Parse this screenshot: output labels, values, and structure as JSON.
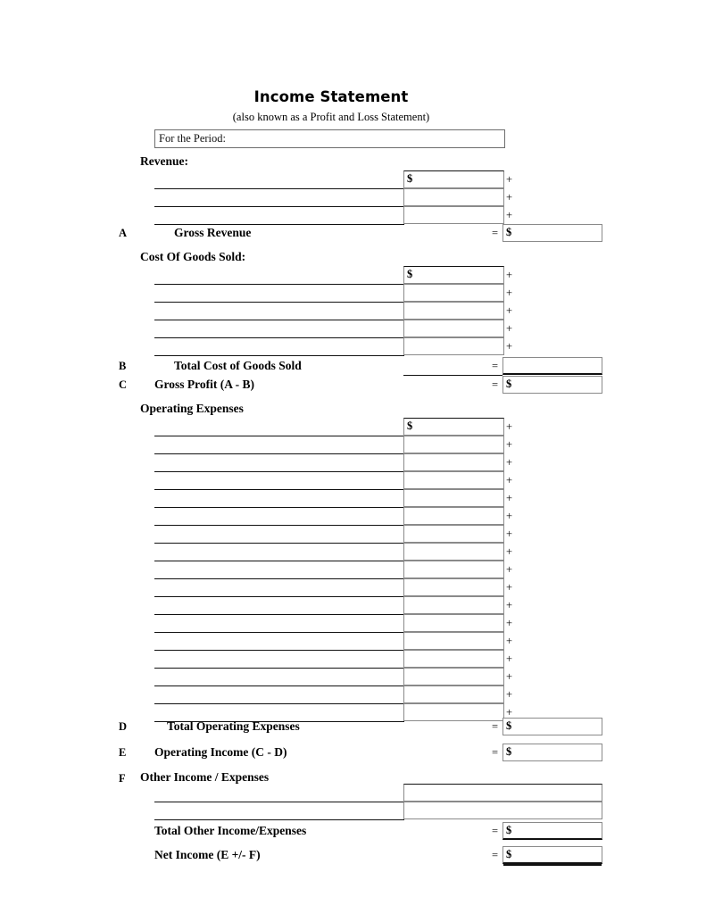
{
  "document": {
    "title": "Income Statement",
    "subtitle": "(also known as a Profit and Loss Statement)"
  },
  "period_field": {
    "label": "For the Period:",
    "value": "",
    "placeholder": ""
  },
  "symbols": {
    "dollar": "$",
    "plus": "+",
    "equals": "="
  },
  "sections": [
    {
      "id": "revenue",
      "heading": "Revenue:",
      "entry_rows": 3,
      "first_row_dollar": true,
      "operator": "+"
    },
    {
      "id": "cogs",
      "heading": "Cost Of Goods Sold:",
      "entry_rows": 5,
      "first_row_dollar": true,
      "operator": "+"
    },
    {
      "id": "opex",
      "heading": "Operating Expenses",
      "entry_rows": 17,
      "first_row_dollar": true,
      "operator": "+"
    },
    {
      "id": "other",
      "heading": "Other Income / Expenses",
      "entry_rows": 2,
      "first_row_dollar": false,
      "operator": ""
    }
  ],
  "totals": {
    "gross_revenue": {
      "letter": "A",
      "label": "Gross Revenue",
      "operator": "=",
      "dollar": "$",
      "value": ""
    },
    "total_cogs": {
      "letter": "B",
      "label": "Total Cost of Goods Sold",
      "operator": "=",
      "dollar": "",
      "value": ""
    },
    "gross_profit": {
      "letter": "C",
      "label": "Gross Profit (A - B)",
      "operator": "=",
      "dollar": "$",
      "value": ""
    },
    "total_opex": {
      "letter": "D",
      "label": "Total Operating Expenses",
      "operator": "=",
      "dollar": "$",
      "value": ""
    },
    "operating_income": {
      "letter": "E",
      "label": "Operating Income (C - D)",
      "operator": "=",
      "dollar": "$",
      "value": ""
    },
    "other_heading": {
      "letter": "F",
      "label": "Other Income / Expenses"
    },
    "total_other": {
      "letter": "",
      "label": "Total Other Income/Expenses",
      "operator": "=",
      "dollar": "$",
      "value": ""
    },
    "net_income": {
      "letter": "",
      "label": "Net Income (E +/- F)",
      "operator": "=",
      "dollar": "$",
      "value": ""
    }
  }
}
